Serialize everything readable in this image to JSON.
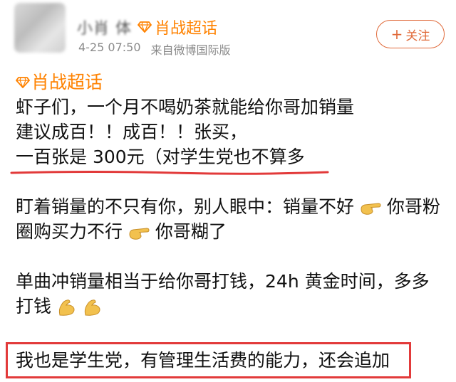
{
  "post": {
    "username": "小肖 体",
    "topic_label": "肖战超话",
    "timestamp": "4-25 07:50",
    "source": "来自微博国际版",
    "follow_label": "关注",
    "inline_topic": "肖战超话"
  },
  "content": {
    "lines": [
      "虾子们，一个月不喝奶茶就能给你哥加销量",
      "建议成百！！成百！！张买，",
      "一百张是 300元（对学生党也不算多"
    ],
    "para2": {
      "line1_a": "盯着销量的不只有你，别人眼中：销量不好",
      "line1_b": "你哥粉",
      "line2_a": "圈购买力不行",
      "line2_b": "你哥糊了"
    },
    "para3": {
      "line1": "单曲冲销量相当于给你哥打钱，24h 黄金时间，多多",
      "line2": "打钱"
    },
    "highlight": "我也是学生党，有管理生活费的能力，还会追加"
  },
  "colors": {
    "topic": "#ff8200",
    "follow": "#e06a3a",
    "annotation": "#e23a3a",
    "meta": "#8a8a8a"
  },
  "icons": [
    "diamond-icon",
    "pointing-hand-emoji",
    "flexed-biceps-emoji"
  ]
}
